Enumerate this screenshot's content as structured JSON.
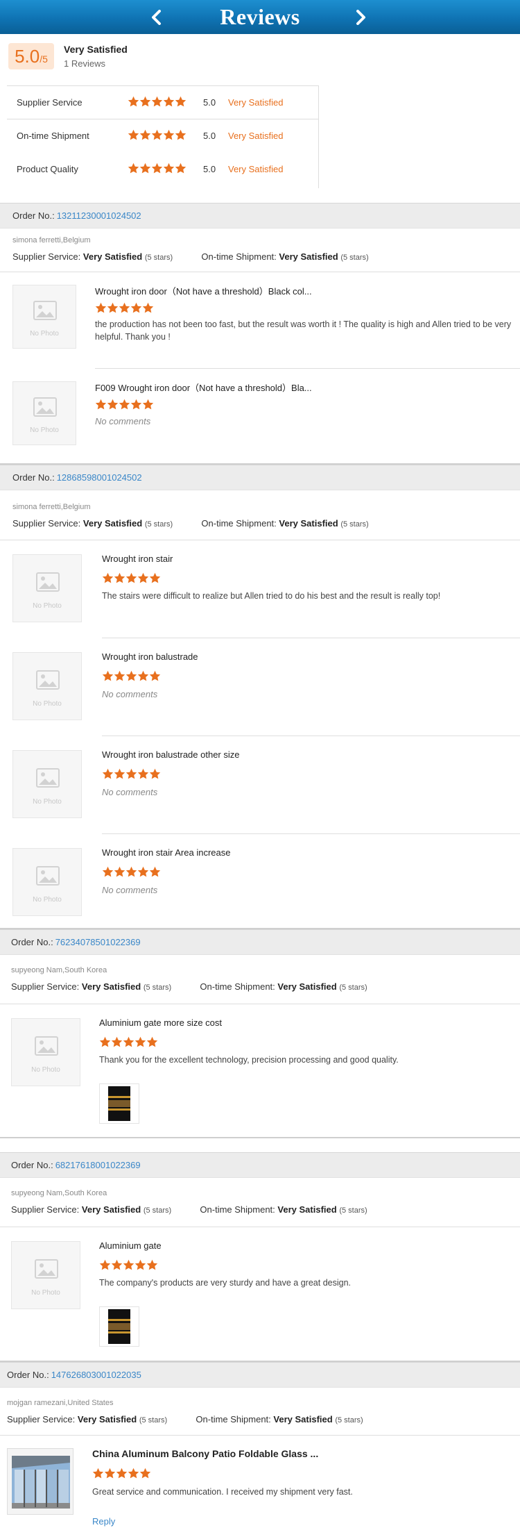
{
  "header": {
    "title": "Reviews",
    "prev_icon": "chevron-left-icon",
    "next_icon": "chevron-right-icon"
  },
  "summary": {
    "score": "5.0",
    "score_max": "/5",
    "rating_text": "Very Satisfied",
    "review_count": "1 Reviews",
    "metrics": [
      {
        "label": "Supplier Service",
        "value": "5.0",
        "text": "Very Satisfied",
        "stars": 5
      },
      {
        "label": "On-time Shipment",
        "value": "5.0",
        "text": "Very Satisfied",
        "stars": 5
      },
      {
        "label": "Product Quality",
        "value": "5.0",
        "text": "Very Satisfied",
        "stars": 5
      }
    ]
  },
  "labels": {
    "order_no": "Order No.:",
    "supplier_service": "Supplier Service:",
    "ontime_shipment": "On-time Shipment:",
    "very_satisfied": "Very Satisfied",
    "five_stars": "(5 stars)",
    "no_photo": "No Photo",
    "no_comments": "No comments",
    "reply": "Reply"
  },
  "orders": [
    {
      "order_no": "13211230001024502",
      "buyer": "simona ferretti,Belgium",
      "items": [
        {
          "name": "Wrought iron door（Not have a threshold）Black col...",
          "stars": 5,
          "comment": "the production has not been too fast, but the result was worth it ! The quality is high and Allen tried to be very helpful. Thank you !"
        },
        {
          "name": "F009 Wrought iron door（Not have a threshold）Bla...",
          "stars": 5,
          "comment": ""
        }
      ]
    },
    {
      "order_no": "12868598001024502",
      "buyer": "simona ferretti,Belgium",
      "items": [
        {
          "name": "Wrought iron stair",
          "stars": 5,
          "comment": "The stairs were difficult to realize but Allen tried to do his best and the result is really top!"
        },
        {
          "name": "Wrought iron balustrade",
          "stars": 5,
          "comment": ""
        },
        {
          "name": "Wrought iron balustrade other size",
          "stars": 5,
          "comment": ""
        },
        {
          "name": "Wrought iron stair Area increase",
          "stars": 5,
          "comment": ""
        }
      ]
    },
    {
      "order_no": "76234078501022369",
      "buyer": "supyeong Nam,South Korea",
      "items": [
        {
          "name": "Aluminium gate more size cost",
          "stars": 5,
          "comment": "Thank you for the excellent technology, precision processing and good quality."
        }
      ]
    },
    {
      "order_no": "68217618001022369",
      "buyer": "supyeong Nam,South Korea",
      "items": [
        {
          "name": "Aluminium gate",
          "stars": 5,
          "comment": "The company's products are very sturdy and have a great design."
        }
      ]
    },
    {
      "order_no": "147626803001022035",
      "buyer": "mojgan ramezani,United States",
      "items": [
        {
          "name": "China Aluminum Balcony Patio Foldable Glass ...",
          "stars": 5,
          "comment": "Great service and communication. I received my shipment very fast."
        }
      ]
    }
  ],
  "colors": {
    "brand_blue": "#0f73b3",
    "star_orange": "#e8701e",
    "link_blue": "#3a87c8"
  }
}
